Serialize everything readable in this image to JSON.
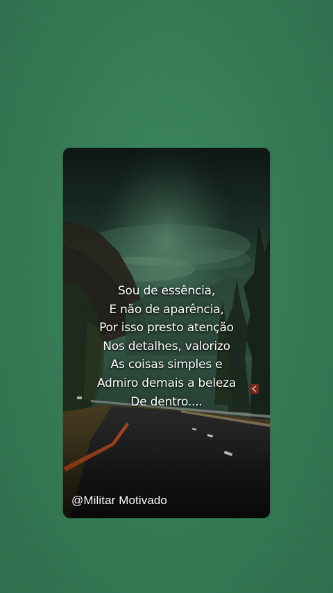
{
  "background_color": "#357a55",
  "quote": {
    "lines": [
      "Sou de essência,",
      "E não de aparência,",
      "Por isso presto atenção",
      "Nos detalhes, valorizo",
      "As coisas simples e",
      "Admiro demais a beleza",
      "De dentro...."
    ]
  },
  "credit": "@Militar Motivado"
}
